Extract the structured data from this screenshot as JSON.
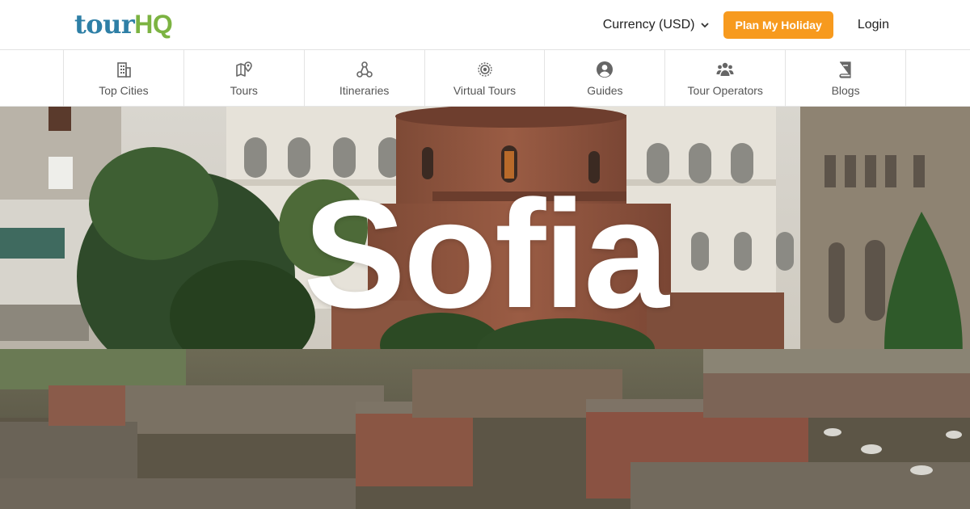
{
  "header": {
    "logo": {
      "part_a": "tour",
      "part_b": "HQ"
    },
    "currency_label": "Currency (USD)",
    "plan_button": "Plan My Holiday",
    "login_label": "Login"
  },
  "nav": {
    "items": [
      {
        "label": "Top Cities",
        "icon": "building-icon"
      },
      {
        "label": "Tours",
        "icon": "map-pin-icon"
      },
      {
        "label": "Itineraries",
        "icon": "network-icon"
      },
      {
        "label": "Virtual Tours",
        "icon": "target-icon"
      },
      {
        "label": "Guides",
        "icon": "user-circle-icon"
      },
      {
        "label": "Tour Operators",
        "icon": "users-icon"
      },
      {
        "label": "Blogs",
        "icon": "book-icon"
      }
    ]
  },
  "hero": {
    "title": "Sofia"
  },
  "colors": {
    "accent": "#f79a1e",
    "logo_blue": "#2e7fa6",
    "logo_green": "#7cb342",
    "nav_icon": "#666666"
  }
}
